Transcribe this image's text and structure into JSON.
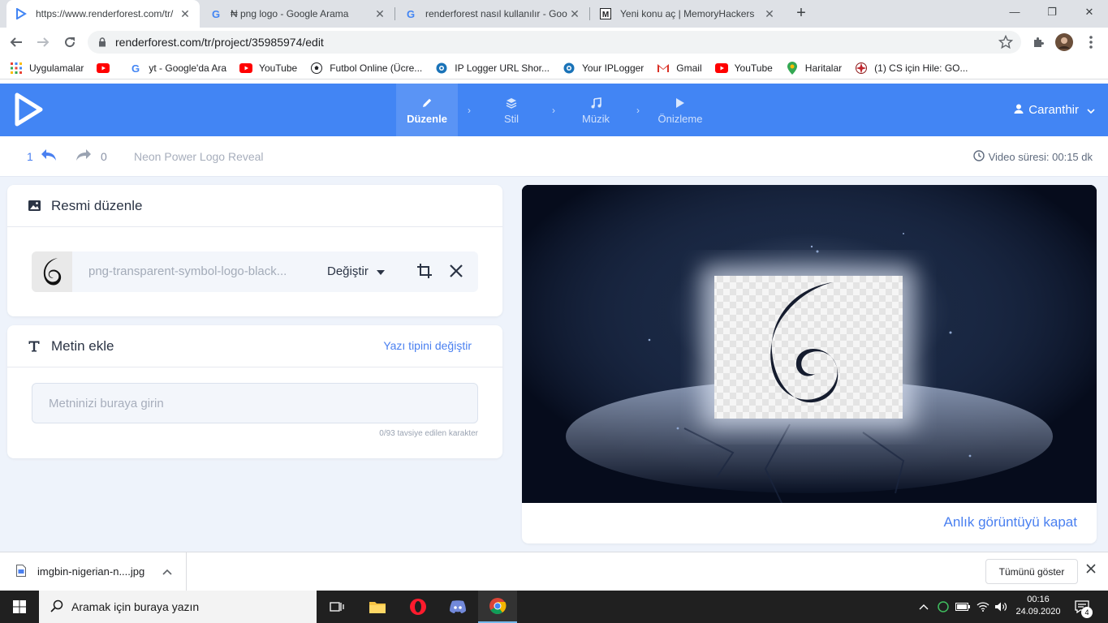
{
  "browser": {
    "tabs": [
      {
        "title": "https://www.renderforest.com/tr/",
        "close": "✕"
      },
      {
        "title": "₦ png logo - Google Arama",
        "close": "✕"
      },
      {
        "title": "renderforest nasıl kullanılır - Goo",
        "close": "✕"
      },
      {
        "title": "Yeni konu aç | MemoryHackers",
        "close": "✕"
      }
    ],
    "new_tab": "+",
    "url": "renderforest.com/tr/project/35985974/edit",
    "bookmarks": [
      {
        "label": "Uygulamalar",
        "icon": "apps-grid-icon"
      },
      {
        "label": "",
        "icon": "youtube-icon"
      },
      {
        "label": "yt - Google'da Ara",
        "icon": "google-icon"
      },
      {
        "label": "YouTube",
        "icon": "youtube-icon"
      },
      {
        "label": "Futbol Online (Ücre...",
        "icon": "football-icon"
      },
      {
        "label": "IP Logger URL Shor...",
        "icon": "iplogger-icon"
      },
      {
        "label": "Your IPLogger",
        "icon": "iplogger-icon"
      },
      {
        "label": "Gmail",
        "icon": "gmail-icon"
      },
      {
        "label": "YouTube",
        "icon": "youtube-icon"
      },
      {
        "label": "Haritalar",
        "icon": "maps-icon"
      },
      {
        "label": "(1) CS için Hile: GO...",
        "icon": "umbrella-icon"
      }
    ]
  },
  "app": {
    "steps": [
      {
        "label": "Düzenle",
        "icon": "pencil-icon",
        "active": true
      },
      {
        "label": "Stil",
        "icon": "layers-icon",
        "active": false
      },
      {
        "label": "Müzik",
        "icon": "music-note-icon",
        "active": false
      },
      {
        "label": "Önizleme",
        "icon": "play-icon",
        "active": false
      }
    ],
    "step_arrow": "›",
    "user": "Caranthir",
    "undo_count": "1",
    "redo_count": "0",
    "project_title": "Neon Power Logo Reveal",
    "duration": "Video süresi: 00:15 dk",
    "image_card": {
      "title": "Resmi düzenle",
      "file_name": "png-transparent-symbol-logo-black...",
      "change_label": "Değiştir"
    },
    "text_card": {
      "title": "Metin ekle",
      "font_link": "Yazı tipini değiştir",
      "placeholder": "Metninizi buraya girin",
      "char_hint": "0/93 tavsiye edilen karakter"
    },
    "snapshot_link": "Anlık görüntüyü kapat"
  },
  "downloads": {
    "file": "imgbin-nigerian-n....jpg",
    "show_all": "Tümünü göster"
  },
  "taskbar": {
    "search_placeholder": "Aramak için buraya yazın",
    "time": "00:16",
    "date": "24.09.2020",
    "notifications": "4"
  },
  "colors": {
    "accent": "#4285f4",
    "link": "#4a80f0",
    "canvas_bg": "#eef3fb"
  }
}
